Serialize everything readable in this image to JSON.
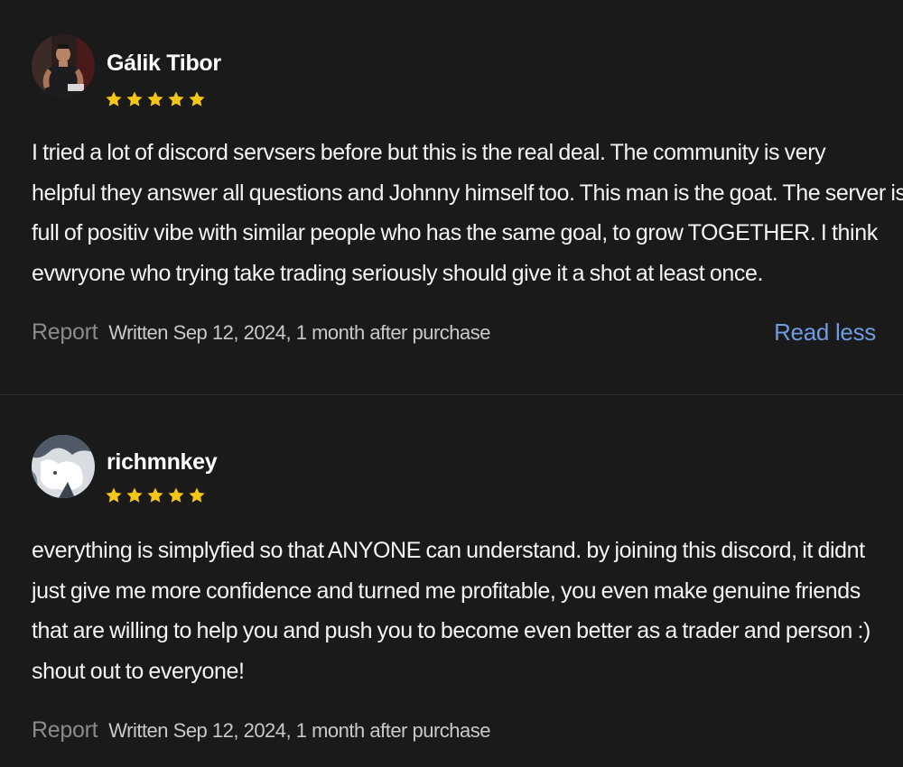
{
  "colors": {
    "background": "#1a1a1b",
    "star": "#f5c518",
    "link": "#6f9be0",
    "muted": "#8a8a8f"
  },
  "reviews": [
    {
      "author": "Gálik Tibor",
      "rating": 5,
      "lines": [
        "I tried a lot of discord servsers before but this is the real deal. The community is very",
        "helpful they answer all questions and Johnny himself too. This man is the goat. The server is",
        "full of positiv vibe with similar people who has the same goal, to grow TOGETHER. I think",
        "evwryone who trying take trading seriously should give it a shot at least once."
      ],
      "report_label": "Report",
      "written": "Written Sep 12, 2024, 1 month after purchase",
      "toggle_label": "Read less"
    },
    {
      "author": "richmnkey",
      "rating": 5,
      "lines": [
        "everything is simplyfied so that ANYONE can understand. by joining this discord, it didnt",
        "just give me more confidence and turned me profitable, you even make genuine friends",
        "that are willing to help you and push you to become even better as a trader and person :)",
        "shout out to everyone!"
      ],
      "report_label": "Report",
      "written": "Written Sep 12, 2024, 1 month after purchase"
    }
  ]
}
